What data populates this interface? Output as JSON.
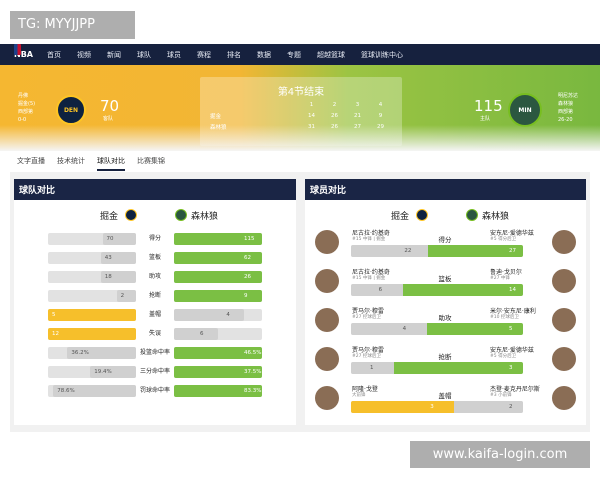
{
  "watermark": {
    "top_left": "TG: MYYJJPP",
    "bottom_right": "www.kaifa-login.com"
  },
  "nav": {
    "logo": "NBA",
    "items": [
      "首页",
      "视频",
      "新闻",
      "球队",
      "球员",
      "赛程",
      "排名",
      "数据",
      "专题",
      "超越篮球",
      "篮球训练中心"
    ]
  },
  "hero": {
    "home": {
      "lines": [
        "丹佛",
        "掘金(5)",
        "西部第",
        "0-0"
      ],
      "score": "70",
      "sub": "客队"
    },
    "away": {
      "lines": [
        "明尼苏达",
        "森林狼",
        "西部第",
        "26-20"
      ],
      "score": "115",
      "sub": "主队"
    },
    "status": "第4节结束",
    "quarter_headers": [
      "1",
      "2",
      "3",
      "4"
    ],
    "quarter_rows": [
      {
        "team": "掘金",
        "q": [
          "14",
          "26",
          "21",
          "9"
        ]
      },
      {
        "team": "森林狼",
        "q": [
          "31",
          "26",
          "27",
          "29"
        ]
      }
    ]
  },
  "tabs": [
    "文字直播",
    "技术统计",
    "球队对比",
    "比赛集锦"
  ],
  "active_tab": 2,
  "team_panel": {
    "title": "球队对比",
    "home": "掘金",
    "away": "森林狼",
    "rows": [
      {
        "label": "得分",
        "left": "70",
        "right": "115",
        "left_frac": 0.38,
        "right_frac": 1.0,
        "left_color": "gray",
        "right_color": "green"
      },
      {
        "label": "篮板",
        "left": "43",
        "right": "62",
        "left_frac": 0.4,
        "right_frac": 1.0,
        "left_color": "gray",
        "right_color": "green"
      },
      {
        "label": "助攻",
        "left": "18",
        "right": "26",
        "left_frac": 0.4,
        "right_frac": 1.0,
        "left_color": "gray",
        "right_color": "green"
      },
      {
        "label": "抢断",
        "left": "2",
        "right": "9",
        "left_frac": 0.22,
        "right_frac": 1.0,
        "left_color": "gray",
        "right_color": "green"
      },
      {
        "label": "盖帽",
        "left": "5",
        "right": "4",
        "left_frac": 1.0,
        "right_frac": 0.8,
        "left_color": "yellow",
        "right_color": "gray"
      },
      {
        "label": "失误",
        "left": "12",
        "right": "6",
        "left_frac": 1.0,
        "right_frac": 0.5,
        "left_color": "yellow",
        "right_color": "gray"
      },
      {
        "label": "投篮命中率",
        "left": "36.2%",
        "right": "46.5%",
        "left_frac": 0.78,
        "right_frac": 1.0,
        "left_color": "gray",
        "right_color": "green"
      },
      {
        "label": "三分命中率",
        "left": "19.4%",
        "right": "37.5%",
        "left_frac": 0.52,
        "right_frac": 1.0,
        "left_color": "gray",
        "right_color": "green"
      },
      {
        "label": "罚球命中率",
        "left": "78.6%",
        "right": "83.3%",
        "left_frac": 0.94,
        "right_frac": 1.0,
        "left_color": "gray",
        "right_color": "green"
      }
    ]
  },
  "player_panel": {
    "title": "球员对比",
    "home": "掘金",
    "away": "森林狼",
    "rows": [
      {
        "label": "得分",
        "left_name": "尼古拉·约基奇",
        "left_sub": "#15 中锋 | 掘金",
        "right_name": "安东尼·爱德华兹",
        "right_sub": "#5 得分后卫",
        "left": "22",
        "right": "27",
        "left_frac": 0.45,
        "right_frac": 0.55,
        "left_color": "gray",
        "right_color": "green"
      },
      {
        "label": "篮板",
        "left_name": "尼古拉·约基奇",
        "left_sub": "#15 中锋 | 掘金",
        "right_name": "鲁迪·戈贝尔",
        "right_sub": "#27 中锋",
        "left": "6",
        "right": "14",
        "left_frac": 0.3,
        "right_frac": 0.7,
        "left_color": "gray",
        "right_color": "green"
      },
      {
        "label": "助攻",
        "left_name": "贾马尔·穆雷",
        "left_sub": "#27 控球后卫",
        "right_name": "米尔·安东尼·康利",
        "right_sub": "#10 控球后卫",
        "left": "4",
        "right": "5",
        "left_frac": 0.44,
        "right_frac": 0.56,
        "left_color": "gray",
        "right_color": "green"
      },
      {
        "label": "抢断",
        "left_name": "贾马尔·穆雷",
        "left_sub": "#27 控球后卫",
        "right_name": "安东尼·爱德华兹",
        "right_sub": "#5 得分后卫",
        "left": "1",
        "right": "3",
        "left_frac": 0.25,
        "right_frac": 0.75,
        "left_color": "gray",
        "right_color": "green"
      },
      {
        "label": "盖帽",
        "left_name": "阿隆·戈登",
        "left_sub": "大前锋",
        "right_name": "杰登·麦克丹尼尔斯",
        "right_sub": "#3 小前锋",
        "left": "3",
        "right": "2",
        "left_frac": 0.6,
        "right_frac": 0.4,
        "left_color": "yellow",
        "right_color": "gray"
      }
    ]
  },
  "colors": {
    "navy": "#16213e",
    "nuggets_gold": "#f6bf2b",
    "wolves_green": "#7bbf44",
    "gray": "#d0d0d0"
  }
}
